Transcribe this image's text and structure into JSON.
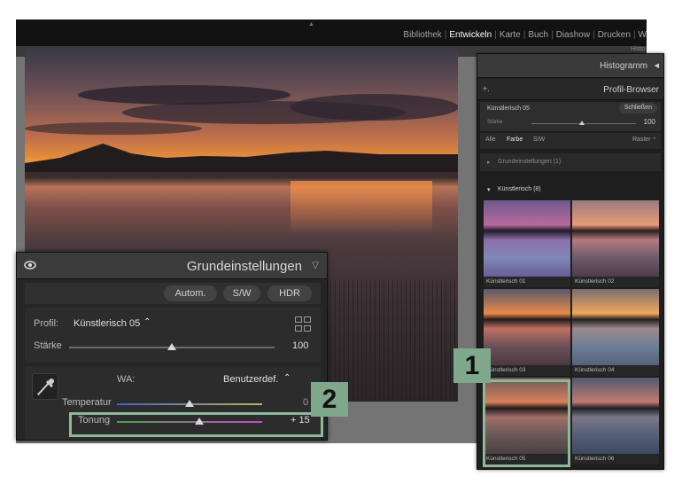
{
  "topbar": {
    "modules": [
      "Bibliothek",
      "Entwickeln",
      "Karte",
      "Buch",
      "Diashow",
      "Drucken",
      "W"
    ],
    "active_module": "Entwickeln",
    "histo_tab": "Histo"
  },
  "right_panel": {
    "histogram_title": "Histogramm",
    "profile_browser": {
      "title": "Profil-Browser",
      "plus": "+.",
      "current_profile": "Künstlerisch 05",
      "close_label": "Schließen",
      "amount_label": "Stärke",
      "amount_value": "100",
      "amount_fraction": 0.48,
      "filters": [
        "Alle",
        "Farbe",
        "S/W"
      ],
      "selected_filter": "Farbe",
      "view_label": "Raster",
      "group_closed": "Grundeinstellungen (1)",
      "group_open": "Künstlerisch (8)",
      "thumbnails": [
        "Künstlerisch 01",
        "Künstlerisch 02",
        "Künstlerisch 03",
        "Künstlerisch 04",
        "Künstlerisch 05",
        "Künstlerisch 06"
      ]
    }
  },
  "basic_panel": {
    "title": "Grundeinstellungen",
    "buttons": [
      "Autom.",
      "S/W",
      "HDR"
    ],
    "profile_label": "Profil:",
    "profile_value": "Künstlerisch 05",
    "amount_label": "Stärke",
    "amount_value": "100",
    "amount_fraction": 0.5,
    "wb_label": "WA:",
    "wb_value": "Benutzerdef.",
    "temperature_label": "Temperatur",
    "temperature_value": "0",
    "temperature_fraction": 0.5,
    "tint_label": "Tonung",
    "tint_value": "+ 15",
    "tint_fraction": 0.57
  },
  "callouts": {
    "one": "1",
    "two": "2"
  },
  "colors": {
    "callout": "#7fa88d",
    "panel": "#2b2b2b"
  }
}
